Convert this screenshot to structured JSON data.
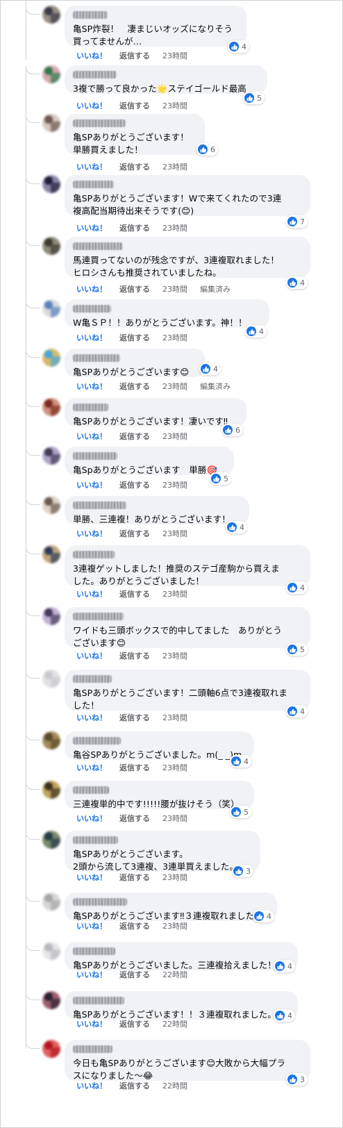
{
  "labels": {
    "like": "いいね！",
    "reply": "返信する",
    "edited": "編集済み"
  },
  "colors": {
    "accent": "#1b74e4",
    "bubble": "#f0f2f5",
    "meta": "#65676b"
  },
  "comments": [
    {
      "text": "亀SP炸裂！　凄まじいオッズになりそう\n買ってませんが…",
      "reactions": "4",
      "time": "23時間",
      "edited": false
    },
    {
      "text": "3複で勝って良かった🌟ステイゴールド最高",
      "reactions": "5",
      "time": "23時間",
      "edited": false
    },
    {
      "text": "亀SPありがとうございます！\n単勝買えました！",
      "reactions": "6",
      "time": "23時間",
      "edited": false
    },
    {
      "text": "亀SPありがとうございます！Wで来てくれたので3連\n複高配当期待出来そうです(😊)",
      "reactions": "7",
      "time": "23時間",
      "edited": false
    },
    {
      "text": "馬連買ってないのが残念ですが、3連複取れました！\nヒロシさんも推奨されていましたね。",
      "reactions": "4",
      "time": "23時間",
      "edited": true
    },
    {
      "text": "W亀ＳＰ！！ありがとうございます。神！！",
      "reactions": "4",
      "time": "23時間",
      "edited": false
    },
    {
      "text": "亀SPありがとうございます😊",
      "reactions": "4",
      "time": "23時間",
      "edited": true
    },
    {
      "text": "亀SPありがとうございます！凄いです‼",
      "reactions": "6",
      "time": "23時間",
      "edited": false
    },
    {
      "text": "亀Spありがとうございます　単勝🎯",
      "reactions": "5",
      "time": "23時間",
      "edited": false
    },
    {
      "text": "単勝、三連複！ありがとうございます！",
      "reactions": "4",
      "time": "23時間",
      "edited": false
    },
    {
      "text": "3連複ゲットしました！推奨のステゴ産駒から買えま\nした。ありがとうございました！",
      "reactions": "4",
      "time": "23時間",
      "edited": false
    },
    {
      "text": "ワイドも三頭ボックスで的中してました　ありがとう\nございます😊",
      "reactions": "5",
      "time": "23時間",
      "edited": false
    },
    {
      "text": "亀SPありがとうございます！二頭軸6点で3連複取れま\nした！",
      "reactions": "4",
      "time": "23時間",
      "edited": false
    },
    {
      "text": "亀谷SPありがとうございました。m(_ _)m",
      "reactions": "4",
      "time": "23時間",
      "edited": false
    },
    {
      "text": "三連複単的中です!!!!!腰が抜けそう（笑）",
      "reactions": "5",
      "time": "23時間",
      "edited": false
    },
    {
      "text": "亀SPありがとうございます。\n2頭から流して3連複、3連単買えました。",
      "reactions": "3",
      "time": "23時間",
      "edited": false
    },
    {
      "text": "亀SPありがとうございます‼３連複取れました!",
      "reactions": "4",
      "time": "23時間",
      "edited": false
    },
    {
      "text": "亀SPありがとうございました。三連複拾えました！",
      "reactions": "4",
      "time": "22時間",
      "edited": false
    },
    {
      "text": "亀SPありがとうございます！！３連複取れました。",
      "reactions": "4",
      "time": "22時間",
      "edited": false
    },
    {
      "text": "今日も亀SPありがとうございます😊大敗から大幅プラ\nスになりました〜😂",
      "reactions": "3",
      "time": "22時間",
      "edited": false
    }
  ]
}
